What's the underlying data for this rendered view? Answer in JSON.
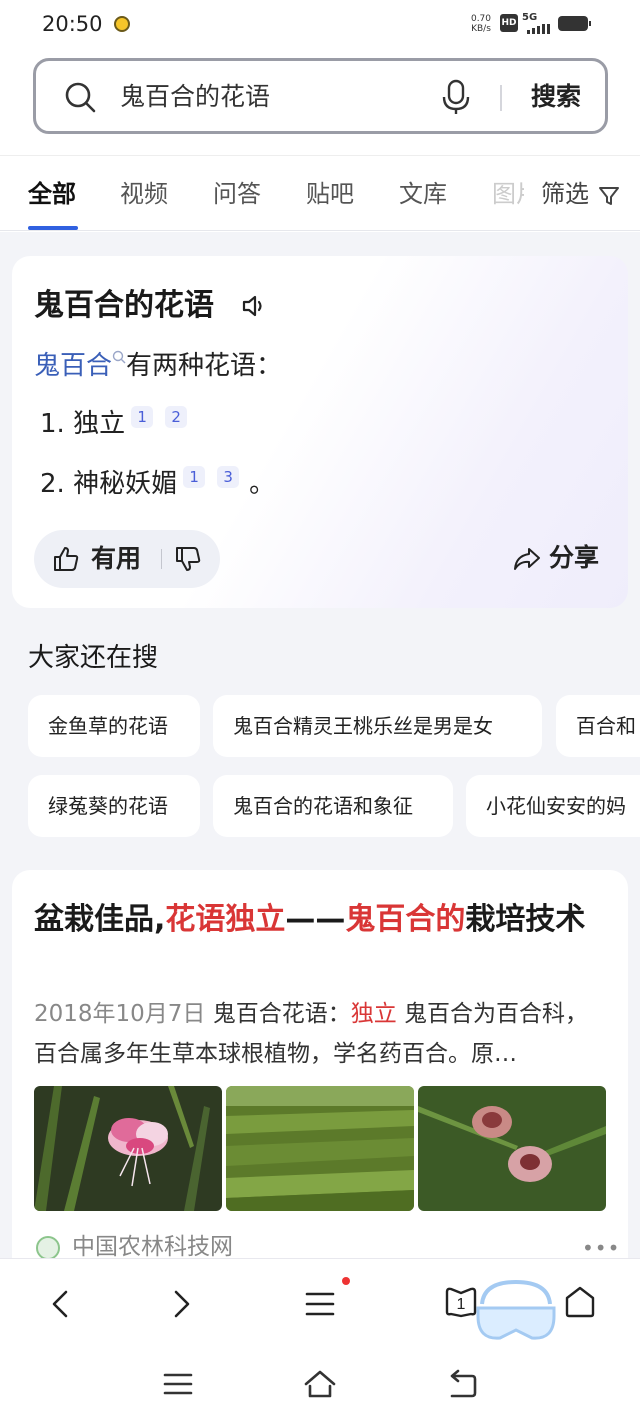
{
  "status_bar": {
    "time": "20:50",
    "net_speed_value": "0.70",
    "net_speed_unit": "KB/s",
    "hd": "HD",
    "network": "5G"
  },
  "search": {
    "query": "鬼百合的花语",
    "button_label": "搜索"
  },
  "tabs": [
    {
      "label": "全部"
    },
    {
      "label": "视频"
    },
    {
      "label": "问答"
    },
    {
      "label": "贴吧"
    },
    {
      "label": "文库"
    },
    {
      "label": "图片"
    }
  ],
  "filter_label": "筛选",
  "answer": {
    "title": "鬼百合的花语",
    "intro_link": "鬼百合",
    "intro_text": "有两种花语：",
    "items": [
      {
        "number": "1.",
        "text": "独立",
        "refs": [
          "1",
          "2"
        ],
        "suffix": ""
      },
      {
        "number": "2.",
        "text": "神秘妖媚",
        "refs": [
          "1",
          "3"
        ],
        "suffix": "。"
      }
    ],
    "useful_label": "有用",
    "share_label": "分享"
  },
  "related": {
    "title": "大家还在搜",
    "row1": [
      "金鱼草的花语",
      "鬼百合精灵王桃乐丝是男是女",
      "百合和"
    ],
    "row2": [
      "绿菟葵的花语",
      "鬼百合的花语和象征",
      "小花仙安安的妈"
    ]
  },
  "result": {
    "title_part1": "盆栽佳品,",
    "title_hl1": "花语独立",
    "title_part2": "——",
    "title_hl2": "鬼百合的",
    "title_part3": "栽培技术",
    "date": "2018年10月7日",
    "snippet_pre": "鬼百合花语：",
    "snippet_hl": "独立",
    "snippet_post": " 鬼百合为百合科，百合属多年生草本球根植物，学名药百合。原…",
    "source": "中国农林科技网",
    "more": "•••"
  }
}
